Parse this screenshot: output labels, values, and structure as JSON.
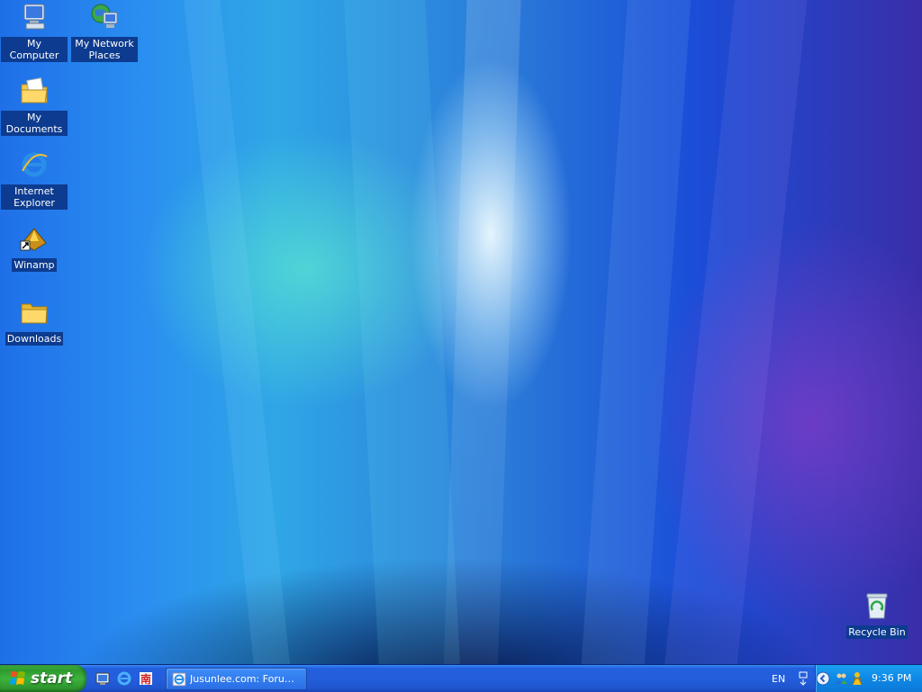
{
  "desktop": {
    "icons": [
      {
        "label": "My Computer",
        "icon": "my-computer-icon"
      },
      {
        "label": "My Network Places",
        "icon": "network-places-icon"
      },
      {
        "label": "My Documents",
        "icon": "my-documents-icon"
      },
      {
        "label": "Internet Explorer",
        "icon": "internet-explorer-icon"
      },
      {
        "label": "Winamp",
        "icon": "winamp-shortcut-icon"
      },
      {
        "label": "Downloads",
        "icon": "folder-icon"
      },
      {
        "label": "Recycle Bin",
        "icon": "recycle-bin-icon"
      }
    ]
  },
  "taskbar": {
    "start_label": "start",
    "quick_launch": [
      "show-desktop-icon",
      "internet-explorer-icon",
      "app-launch-icon"
    ],
    "tasks": [
      {
        "label": "Jusunlee.com: Forum...",
        "icon": "internet-explorer-icon"
      }
    ],
    "language": "EN",
    "clock": "9:36 PM"
  },
  "colors": {
    "taskbar_blue": "#245edb",
    "start_green": "#3cb43c",
    "tray_blue": "#0e88e6",
    "label_bg": "#0c3b8f"
  }
}
